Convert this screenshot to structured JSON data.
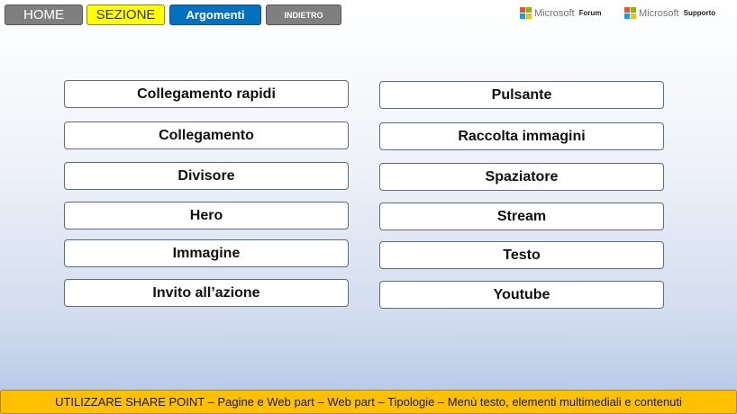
{
  "nav": {
    "home": "HOME",
    "sezione": "SEZIONE",
    "argomenti": "Argomenti",
    "indietro": "INDIETRO"
  },
  "links": {
    "forum": {
      "brand": "Microsoft",
      "label": "Forum"
    },
    "supporto": {
      "brand": "Microsoft",
      "label": "Supporto"
    }
  },
  "logo_colors": [
    "#f25022",
    "#7fba00",
    "#00a4ef",
    "#ffb900"
  ],
  "topics": {
    "left": [
      "Collegamento rapidi",
      "Collegamento",
      "Divisore",
      "Hero",
      "Immagine",
      "Invito all’azione"
    ],
    "right": [
      "Pulsante",
      "Raccolta immagini",
      "Spaziatore",
      "Stream",
      "Testo",
      "Youtube"
    ]
  },
  "footer": "UTILIZZARE SHARE POINT – Pagine e Web part – Web part – Tipologie – Menù testo, elementi multimediali e contenuti"
}
